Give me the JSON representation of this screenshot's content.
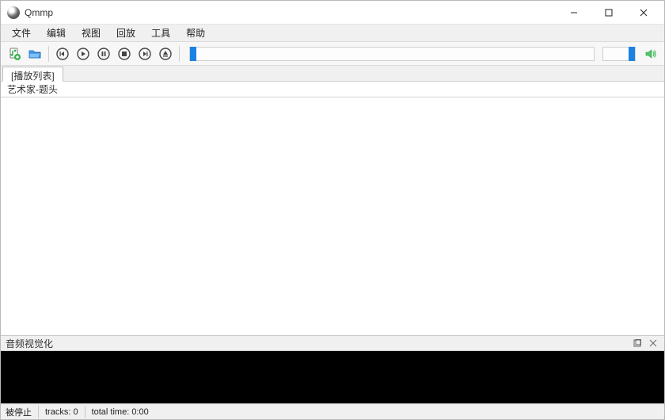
{
  "window": {
    "title": "Qmmp"
  },
  "menu": {
    "file": "文件",
    "edit": "编辑",
    "view": "视图",
    "playback": "回放",
    "tools": "工具",
    "help": "帮助"
  },
  "playlist": {
    "tab_label": "[播放列表]",
    "column_header": "艺术家-题头"
  },
  "visualizer": {
    "title": "音频视觉化"
  },
  "status": {
    "state": "被停止",
    "tracks_label": "tracks: 0",
    "total_time_label": "total time: 0:00"
  },
  "icons": {
    "add_file": "add-file-icon",
    "open_folder": "folder-icon",
    "prev": "previous-icon",
    "play": "play-icon",
    "pause": "pause-icon",
    "stop": "stop-icon",
    "next": "next-icon",
    "eject": "eject-icon",
    "speaker": "speaker-icon"
  },
  "colors": {
    "accent": "#1a82e2",
    "folder": "#4aa3ff",
    "green": "#35b34a"
  }
}
